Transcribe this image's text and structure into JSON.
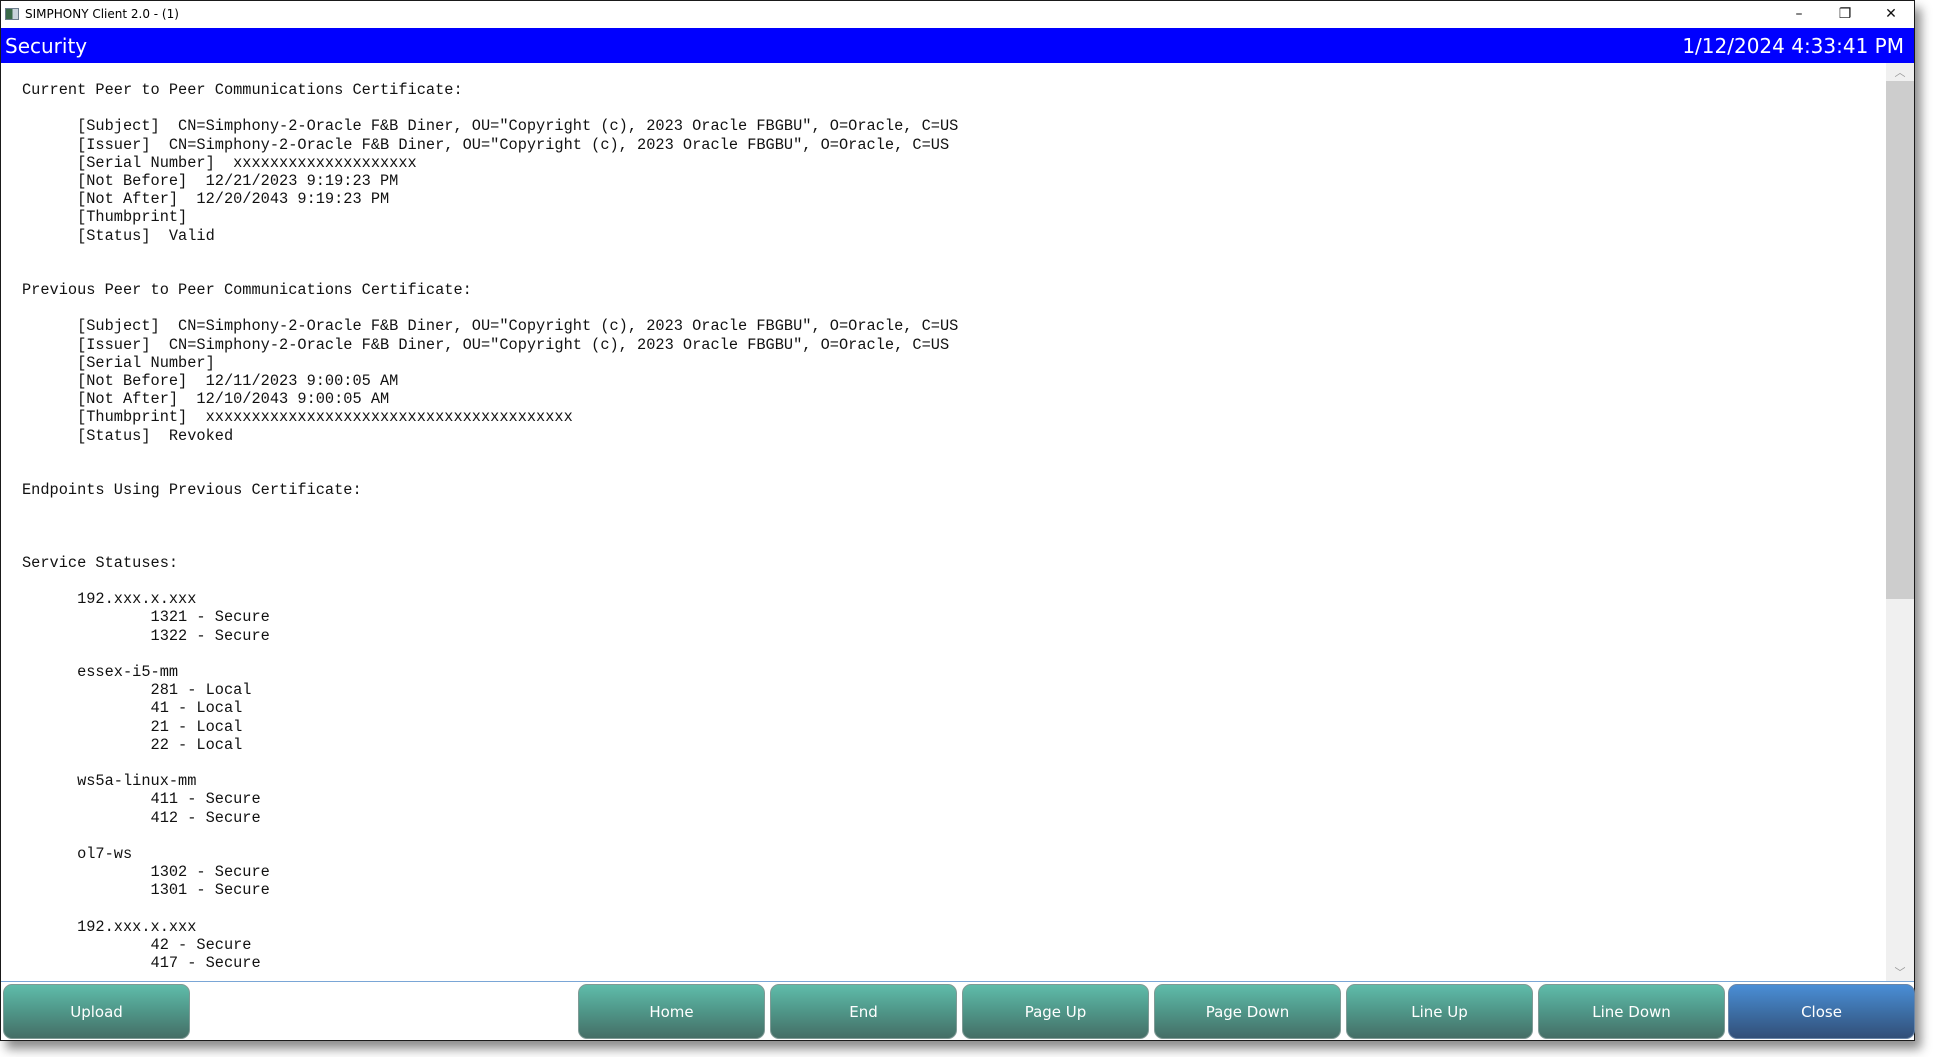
{
  "window": {
    "title": "SIMPHONY Client 2.0 - (1)",
    "controls": {
      "minimize": "–",
      "restore": "❐",
      "close": "✕"
    }
  },
  "header": {
    "title": "Security",
    "datetime": "1/12/2024 4:33:41 PM",
    "color": "#0000ff"
  },
  "report": {
    "current_cert": {
      "heading": "Current Peer to Peer Communications Certificate:",
      "subject": "CN=Simphony-2-Oracle F&B Diner, OU=\"Copyright (c), 2023 Oracle FBGBU\", O=Oracle, C=US",
      "issuer": "CN=Simphony-2-Oracle F&B Diner, OU=\"Copyright (c), 2023 Oracle FBGBU\", O=Oracle, C=US",
      "serial_number": "xxxxxxxxxxxxxxxxxxxx",
      "not_before": "12/21/2023 9:19:23 PM",
      "not_after": "12/20/2043 9:19:23 PM",
      "thumbprint": "",
      "status": "Valid"
    },
    "previous_cert": {
      "heading": "Previous Peer to Peer Communications Certificate:",
      "subject": "CN=Simphony-2-Oracle F&B Diner, OU=\"Copyright (c), 2023 Oracle FBGBU\", O=Oracle, C=US",
      "issuer": "CN=Simphony-2-Oracle F&B Diner, OU=\"Copyright (c), 2023 Oracle FBGBU\", O=Oracle, C=US",
      "serial_number": "",
      "not_before": "12/11/2023 9:00:05 AM",
      "not_after": "12/10/2043 9:00:05 AM",
      "thumbprint": "xxxxxxxxxxxxxxxxxxxxxxxxxxxxxxxxxxxxxxxx",
      "status": "Revoked"
    },
    "field_labels": {
      "subject": "[Subject]",
      "issuer": "[Issuer]",
      "serial_number": "[Serial Number]",
      "not_before": "[Not Before]",
      "not_after": "[Not After]",
      "thumbprint": "[Thumbprint]",
      "status": "[Status]"
    },
    "endpoints_heading": "Endpoints Using Previous Certificate:",
    "service_statuses_heading": "Service Statuses:",
    "hosts": [
      {
        "name": "192.xxx.x.xxx",
        "services": [
          "1321 - Secure",
          "1322 - Secure"
        ]
      },
      {
        "name": "essex-i5-mm",
        "services": [
          "281 - Local",
          "41 - Local",
          "21 - Local",
          "22 - Local"
        ]
      },
      {
        "name": "ws5a-linux-mm",
        "services": [
          "411 - Secure",
          "412 - Secure"
        ]
      },
      {
        "name": "ol7-ws",
        "services": [
          "1302 - Secure",
          "1301 - Secure"
        ]
      },
      {
        "name": "192.xxx.x.xxx",
        "services": [
          "42 - Secure",
          "417 - Secure"
        ]
      }
    ]
  },
  "scrollbar": {
    "position_fraction": 0.0,
    "visible_fraction": 0.58
  },
  "buttons": {
    "upload": "Upload",
    "home": "Home",
    "end": "End",
    "page_up": "Page Up",
    "page_down": "Page Down",
    "line_up": "Line Up",
    "line_down": "Line Down",
    "close": "Close"
  }
}
